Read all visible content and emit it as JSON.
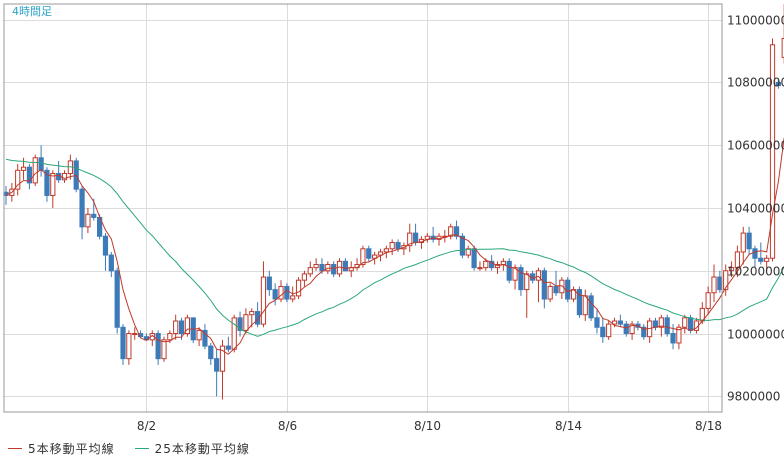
{
  "chart_data": {
    "type": "candlestick",
    "title": "4時間足",
    "grid": true,
    "colors": {
      "up": "#c0392b",
      "down": "#3d7ab8",
      "ma5": "#c0392b",
      "ma25": "#2aa876",
      "grid": "#dcdcdc",
      "frame": "#999999",
      "title": "#2aa3c9"
    },
    "ylim": [
      9750000,
      11050000
    ],
    "yticks": [
      9800000,
      10000000,
      10200000,
      10400000,
      10600000,
      10800000,
      11000000
    ],
    "ytick_labels": [
      "9800000",
      "10000000",
      "10200000",
      "10400000",
      "10600000",
      "10800000",
      "11000000"
    ],
    "x_range": [
      0,
      121
    ],
    "xticks": [
      {
        "pos": 24,
        "label": "8/2"
      },
      {
        "pos": 48,
        "label": "8/6"
      },
      {
        "pos": 72,
        "label": "8/10"
      },
      {
        "pos": 96,
        "label": "8/14"
      },
      {
        "pos": 120,
        "label": "8/18"
      }
    ],
    "series": [
      {
        "name": "5本移動平均線",
        "key": "ma5"
      },
      {
        "name": "25本移動平均線",
        "key": "ma25"
      }
    ],
    "candles": [
      [
        10450000,
        10470000,
        10410000,
        10440000
      ],
      [
        10440000,
        10480000,
        10420000,
        10460000
      ],
      [
        10460000,
        10540000,
        10440000,
        10520000
      ],
      [
        10520000,
        10560000,
        10490000,
        10530000
      ],
      [
        10530000,
        10540000,
        10460000,
        10480000
      ],
      [
        10480000,
        10570000,
        10470000,
        10560000
      ],
      [
        10560000,
        10600000,
        10500000,
        10520000
      ],
      [
        10520000,
        10530000,
        10420000,
        10440000
      ],
      [
        10440000,
        10520000,
        10400000,
        10510000
      ],
      [
        10510000,
        10550000,
        10480000,
        10490000
      ],
      [
        10490000,
        10520000,
        10480000,
        10510000
      ],
      [
        10510000,
        10570000,
        10490000,
        10550000
      ],
      [
        10550000,
        10560000,
        10450000,
        10460000
      ],
      [
        10460000,
        10470000,
        10300000,
        10340000
      ],
      [
        10340000,
        10400000,
        10320000,
        10380000
      ],
      [
        10380000,
        10430000,
        10360000,
        10370000
      ],
      [
        10370000,
        10380000,
        10300000,
        10310000
      ],
      [
        10310000,
        10320000,
        10200000,
        10250000
      ],
      [
        10250000,
        10260000,
        10180000,
        10200000
      ],
      [
        10200000,
        10210000,
        10000000,
        10020000
      ],
      [
        10020000,
        10030000,
        9900000,
        9920000
      ],
      [
        9920000,
        10010000,
        9900000,
        10000000
      ],
      [
        10000000,
        10020000,
        9980000,
        10000000
      ],
      [
        10000000,
        10010000,
        9990000,
        9990000
      ],
      [
        9990000,
        10000000,
        9980000,
        9980000
      ],
      [
        9980000,
        10010000,
        9960000,
        10000000
      ],
      [
        10000000,
        10010000,
        9900000,
        9920000
      ],
      [
        9920000,
        9990000,
        9910000,
        9980000
      ],
      [
        9980000,
        10010000,
        9970000,
        10000000
      ],
      [
        10000000,
        10060000,
        9980000,
        10040000
      ],
      [
        10040000,
        10050000,
        9980000,
        10000000
      ],
      [
        10000000,
        10060000,
        9990000,
        10050000
      ],
      [
        10050000,
        10050000,
        9970000,
        9980000
      ],
      [
        9980000,
        10020000,
        9960000,
        10010000
      ],
      [
        10010000,
        10030000,
        9950000,
        9960000
      ],
      [
        9960000,
        9970000,
        9900000,
        9920000
      ],
      [
        9920000,
        9950000,
        9800000,
        9880000
      ],
      [
        9880000,
        9980000,
        9790000,
        9960000
      ],
      [
        9960000,
        9990000,
        9940000,
        9950000
      ],
      [
        9950000,
        10060000,
        9940000,
        10050000
      ],
      [
        10050000,
        10070000,
        9990000,
        10010000
      ],
      [
        10010000,
        10080000,
        10000000,
        10060000
      ],
      [
        10060000,
        10080000,
        10020000,
        10070000
      ],
      [
        10070000,
        10100000,
        10020000,
        10030000
      ],
      [
        10030000,
        10230000,
        10020000,
        10180000
      ],
      [
        10180000,
        10200000,
        10120000,
        10140000
      ],
      [
        10140000,
        10160000,
        10090000,
        10110000
      ],
      [
        10110000,
        10170000,
        10100000,
        10150000
      ],
      [
        10150000,
        10160000,
        10100000,
        10110000
      ],
      [
        10110000,
        10150000,
        10100000,
        10120000
      ],
      [
        10120000,
        10180000,
        10110000,
        10170000
      ],
      [
        10170000,
        10200000,
        10150000,
        10190000
      ],
      [
        10190000,
        10230000,
        10180000,
        10210000
      ],
      [
        10210000,
        10240000,
        10200000,
        10220000
      ],
      [
        10220000,
        10240000,
        10190000,
        10200000
      ],
      [
        10200000,
        10230000,
        10190000,
        10220000
      ],
      [
        10220000,
        10230000,
        10180000,
        10190000
      ],
      [
        10190000,
        10240000,
        10180000,
        10230000
      ],
      [
        10230000,
        10240000,
        10200000,
        10200000
      ],
      [
        10200000,
        10230000,
        10180000,
        10210000
      ],
      [
        10210000,
        10240000,
        10200000,
        10220000
      ],
      [
        10220000,
        10280000,
        10210000,
        10270000
      ],
      [
        10270000,
        10280000,
        10230000,
        10240000
      ],
      [
        10240000,
        10260000,
        10220000,
        10250000
      ],
      [
        10250000,
        10270000,
        10230000,
        10260000
      ],
      [
        10260000,
        10280000,
        10240000,
        10270000
      ],
      [
        10270000,
        10300000,
        10250000,
        10290000
      ],
      [
        10290000,
        10300000,
        10260000,
        10270000
      ],
      [
        10270000,
        10290000,
        10250000,
        10280000
      ],
      [
        10280000,
        10350000,
        10260000,
        10320000
      ],
      [
        10320000,
        10350000,
        10280000,
        10290000
      ],
      [
        10290000,
        10310000,
        10270000,
        10300000
      ],
      [
        10300000,
        10320000,
        10290000,
        10310000
      ],
      [
        10310000,
        10340000,
        10290000,
        10300000
      ],
      [
        10300000,
        10320000,
        10280000,
        10310000
      ],
      [
        10310000,
        10330000,
        10290000,
        10310000
      ],
      [
        10310000,
        10350000,
        10300000,
        10340000
      ],
      [
        10340000,
        10360000,
        10300000,
        10310000
      ],
      [
        10310000,
        10320000,
        10240000,
        10250000
      ],
      [
        10250000,
        10280000,
        10240000,
        10270000
      ],
      [
        10270000,
        10280000,
        10200000,
        10210000
      ],
      [
        10210000,
        10230000,
        10200000,
        10210000
      ],
      [
        10210000,
        10240000,
        10200000,
        10230000
      ],
      [
        10230000,
        10250000,
        10200000,
        10210000
      ],
      [
        10210000,
        10230000,
        10190000,
        10220000
      ],
      [
        10220000,
        10240000,
        10200000,
        10230000
      ],
      [
        10230000,
        10240000,
        10160000,
        10170000
      ],
      [
        10170000,
        10220000,
        10140000,
        10210000
      ],
      [
        10210000,
        10220000,
        10120000,
        10140000
      ],
      [
        10140000,
        10200000,
        10050000,
        10190000
      ],
      [
        10190000,
        10200000,
        10160000,
        10170000
      ],
      [
        10170000,
        10210000,
        10100000,
        10200000
      ],
      [
        10200000,
        10210000,
        10080000,
        10110000
      ],
      [
        10110000,
        10160000,
        10100000,
        10150000
      ],
      [
        10150000,
        10200000,
        10120000,
        10130000
      ],
      [
        10130000,
        10180000,
        10110000,
        10170000
      ],
      [
        10170000,
        10180000,
        10100000,
        10110000
      ],
      [
        10110000,
        10150000,
        10100000,
        10140000
      ],
      [
        10140000,
        10150000,
        10050000,
        10060000
      ],
      [
        10060000,
        10140000,
        10040000,
        10120000
      ],
      [
        10120000,
        10130000,
        10040000,
        10050000
      ],
      [
        10050000,
        10080000,
        10000000,
        10020000
      ],
      [
        10020000,
        10050000,
        9970000,
        9990000
      ],
      [
        9990000,
        10040000,
        9980000,
        10030000
      ],
      [
        10030000,
        10050000,
        10020000,
        10040000
      ],
      [
        10040000,
        10060000,
        10020000,
        10030000
      ],
      [
        10030000,
        10040000,
        9990000,
        10000000
      ],
      [
        10000000,
        10040000,
        9980000,
        10030000
      ],
      [
        10030000,
        10040000,
        10010000,
        10020000
      ],
      [
        10020000,
        10030000,
        9980000,
        9990000
      ],
      [
        9990000,
        10050000,
        9970000,
        10040000
      ],
      [
        10040000,
        10050000,
        10010000,
        10020000
      ],
      [
        10020000,
        10060000,
        9990000,
        10050000
      ],
      [
        10050000,
        10060000,
        9990000,
        10000000
      ],
      [
        10000000,
        10030000,
        9950000,
        9970000
      ],
      [
        9970000,
        10030000,
        9950000,
        10020000
      ],
      [
        10020000,
        10060000,
        10000000,
        10050000
      ],
      [
        10050000,
        10060000,
        10000000,
        10010000
      ],
      [
        10010000,
        10050000,
        10000000,
        10040000
      ],
      [
        10040000,
        10100000,
        10030000,
        10080000
      ],
      [
        10080000,
        10150000,
        10060000,
        10130000
      ],
      [
        10130000,
        10220000,
        10100000,
        10180000
      ],
      [
        10180000,
        10200000,
        10130000,
        10140000
      ],
      [
        10140000,
        10220000,
        10120000,
        10200000
      ],
      [
        10200000,
        10230000,
        10180000,
        10210000
      ],
      [
        10210000,
        10280000,
        10180000,
        10260000
      ],
      [
        10260000,
        10340000,
        10220000,
        10320000
      ],
      [
        10320000,
        10340000,
        10250000,
        10270000
      ],
      [
        10270000,
        10280000,
        10210000,
        10240000
      ],
      [
        10240000,
        10290000,
        10220000,
        10230000
      ],
      [
        10230000,
        10250000,
        10200000,
        10240000
      ],
      [
        10240000,
        10940000,
        10230000,
        10920000
      ],
      [
        10800000,
        10810000,
        10780000,
        10790000
      ],
      [
        10880000,
        11050000,
        10860000,
        10940000
      ]
    ]
  }
}
